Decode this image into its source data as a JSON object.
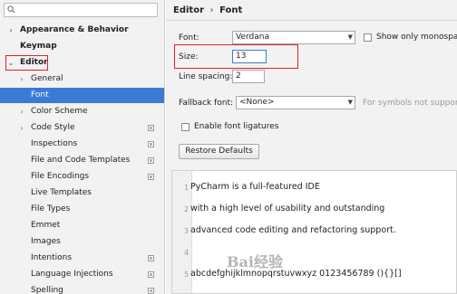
{
  "sidebar": {
    "items": [
      {
        "label": "Appearance & Behavior",
        "arrow": "›"
      },
      {
        "label": "Keymap",
        "arrow": ""
      },
      {
        "label": "Editor",
        "arrow": "⌄"
      },
      {
        "label": "General",
        "arrow": "›"
      },
      {
        "label": "Font",
        "arrow": ""
      },
      {
        "label": "Color Scheme",
        "arrow": "›"
      },
      {
        "label": "Code Style",
        "arrow": "›"
      },
      {
        "label": "Inspections",
        "arrow": ""
      },
      {
        "label": "File and Code Templates",
        "arrow": ""
      },
      {
        "label": "File Encodings",
        "arrow": ""
      },
      {
        "label": "Live Templates",
        "arrow": ""
      },
      {
        "label": "File Types",
        "arrow": ""
      },
      {
        "label": "Emmet",
        "arrow": ""
      },
      {
        "label": "Images",
        "arrow": ""
      },
      {
        "label": "Intentions",
        "arrow": ""
      },
      {
        "label": "Language Injections",
        "arrow": ""
      },
      {
        "label": "Spelling",
        "arrow": ""
      }
    ]
  },
  "breadcrumb": {
    "root": "Editor",
    "sep": "›",
    "leaf": "Font"
  },
  "font": {
    "font_label": "Font:",
    "font_value": "Verdana",
    "show_mono_label": "Show only monospace",
    "size_label": "Size:",
    "size_value": "13",
    "line_spacing_label": "Line spacing:",
    "line_spacing_value": "2",
    "fallback_label": "Fallback font:",
    "fallback_value": "<None>",
    "fallback_hint": "For symbols not supported",
    "ligatures_label": "Enable font ligatures",
    "restore_label": "Restore Defaults"
  },
  "preview": {
    "lines": [
      {
        "num": "1",
        "text": "PyCharm is a full-featured IDE"
      },
      {
        "num": "2",
        "text": "with a high level of usability and outstanding"
      },
      {
        "num": "3",
        "text": "advanced code editing and refactoring support."
      },
      {
        "num": "4",
        "text": ""
      },
      {
        "num": "5",
        "text": "abcdefghijklmnopqrstuvwxyz 0123456789 (){}[]"
      }
    ]
  },
  "watermark": "Bai经验",
  "colors": {
    "selection": "#3a7bd5",
    "highlight_box": "#e02020"
  }
}
